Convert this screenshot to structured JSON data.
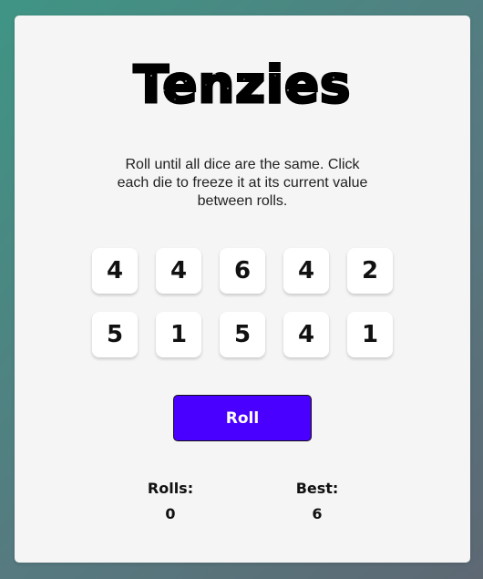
{
  "game": {
    "title": "Tenzies",
    "instructions": "Roll until all dice are the same. Click each die to freeze it at its current value between rolls.",
    "dice": [
      4,
      4,
      6,
      4,
      2,
      5,
      1,
      5,
      4,
      1
    ],
    "roll_label": "Roll",
    "stats": {
      "rolls_label": "Rolls:",
      "rolls_value": "0",
      "best_label": "Best:",
      "best_value": "6"
    }
  },
  "colors": {
    "background_gradient": [
      "#3f9585",
      "#5d6873"
    ],
    "card": "#f5f5f5",
    "die": "#ffffff",
    "roll_button": "#4a00ff",
    "text": "#111111"
  }
}
